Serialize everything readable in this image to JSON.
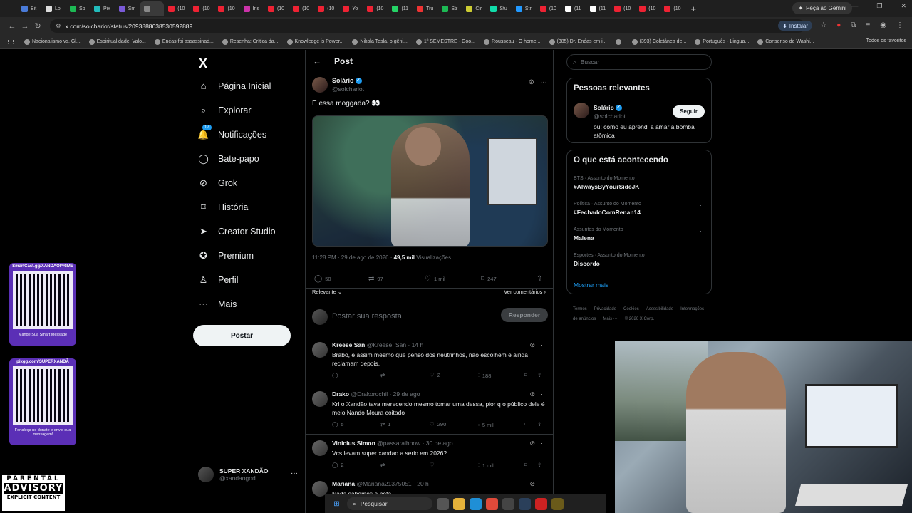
{
  "browser": {
    "tabs": [
      {
        "label": "Bit"
      },
      {
        "label": "Lo"
      },
      {
        "label": "Sp"
      },
      {
        "label": "Pix"
      },
      {
        "label": "Sm"
      },
      {
        "label": ""
      },
      {
        "label": "(10"
      },
      {
        "label": "(10"
      },
      {
        "label": "(10"
      },
      {
        "label": "Ins"
      },
      {
        "label": "(10"
      },
      {
        "label": "(10"
      },
      {
        "label": "(10"
      },
      {
        "label": "Yo"
      },
      {
        "label": "(10"
      },
      {
        "label": "(11"
      },
      {
        "label": "Tru"
      },
      {
        "label": "Str"
      },
      {
        "label": "Cir"
      },
      {
        "label": "Stu"
      },
      {
        "label": "Str"
      },
      {
        "label": "(10"
      },
      {
        "label": "(11"
      },
      {
        "label": "(11"
      },
      {
        "label": "(10"
      },
      {
        "label": "(10"
      },
      {
        "label": "(10"
      }
    ],
    "gemini_label": "Peça ao Gemini",
    "url": "x.com/solchariot/status/2093888638530592889",
    "install_label": "Instalar",
    "bookmarks": [
      "Nacionalismo vs. Gl...",
      "Espiritualidade, Valo...",
      "Enéas foi assassinad...",
      "Resenha: Crítica da...",
      "Knowledge is Power...",
      "Nikola Tesla, o gêni...",
      "1º SEMESTRE - Goo...",
      "Rousseau - O home...",
      "(385) Dr. Enéas em i...",
      "",
      "(393) Coletânea de...",
      "Português - Lingua...",
      "Consenso de Washi..."
    ],
    "all_bookmarks": "Todos os favoritos"
  },
  "sidebar": {
    "logo": "X",
    "items": [
      {
        "label": "Página Inicial",
        "icon": "home-icon"
      },
      {
        "label": "Explorar",
        "icon": "search-icon"
      },
      {
        "label": "Notificações",
        "icon": "bell-icon",
        "badge": "17"
      },
      {
        "label": "Bate-papo",
        "icon": "chat-icon"
      },
      {
        "label": "Grok",
        "icon": "grok-icon"
      },
      {
        "label": "História",
        "icon": "bookmark-icon"
      },
      {
        "label": "Creator Studio",
        "icon": "rocket-icon"
      },
      {
        "label": "Premium",
        "icon": "premium-icon"
      },
      {
        "label": "Perfil",
        "icon": "user-icon"
      },
      {
        "label": "Mais",
        "icon": "more-icon"
      }
    ],
    "post_button": "Postar",
    "account": {
      "name": "SUPER XANDÃO",
      "handle": "@xandaogod"
    }
  },
  "overlay": {
    "qr1_top": "SmartCast.gg/XANDAOPRIME",
    "qr1_bottom": "Mande Sua Smart Message",
    "qr2_top": "pixgg.com/SUPERXANDÃ",
    "qr2_bottom": "Fortaleça no donate e envie sua mensagem!",
    "advisory_1": "PARENTAL",
    "advisory_2": "ADVISORY",
    "advisory_3": "EXPLICIT CONTENT"
  },
  "post": {
    "header": "Post",
    "author_name": "Solário",
    "author_handle": "@solchariot",
    "text": "E essa moggada? 👀",
    "time": "11:28 PM · 29 de ago de 2026 · ",
    "views_count": "49,5 mil",
    "views_label": " Visualizações",
    "replies": "50",
    "reposts": "97",
    "likes": "1 mil",
    "bookmarks": "247",
    "sort_label": "Relevante",
    "comments_link": "Ver comentários",
    "reply_placeholder": "Postar sua resposta",
    "reply_button": "Responder"
  },
  "replies": [
    {
      "name": "Kreese San",
      "handle": "@Kreese_San",
      "time": "· 14 h",
      "text": "Brabo, é assim mesmo que penso dos neutrinhos, não escolhem e ainda reclamam depois.",
      "replies": "",
      "reposts": "",
      "likes": "2",
      "views": "188"
    },
    {
      "name": "Drako",
      "handle": "@Drakorochil",
      "time": "· 29 de ago",
      "text": "Krl o Xandão tava merecendo mesmo tomar uma dessa, pior q o público dele é meio Nando Moura coitado",
      "replies": "5",
      "reposts": "1",
      "likes": "290",
      "views": "5 mil"
    },
    {
      "name": "Vinicius Simon",
      "handle": "@passaralhoow",
      "time": "· 30 de ago",
      "text": "Vcs levam super xandao a serio em 2026?",
      "replies": "2",
      "reposts": "",
      "likes": "",
      "views": "1 mil"
    },
    {
      "name": "Mariana",
      "handle": "@Mariana21375051",
      "time": "· 20 h",
      "text": "Nada sabemos a beta.",
      "replies": "",
      "reposts": "",
      "likes": "",
      "views": ""
    }
  ],
  "right": {
    "search_placeholder": "Buscar",
    "relevant_title": "Pessoas relevantes",
    "relevant_name": "Solário",
    "relevant_handle": "@solchariot",
    "follow_label": "Seguir",
    "relevant_bio": "ou: como eu aprendi a amar a bomba atômica",
    "trends_title": "O que está acontecendo",
    "trends": [
      {
        "meta": "BTS · Assunto do Momento",
        "name": "#AlwaysByYourSideJK"
      },
      {
        "meta": "Política · Assunto do Momento",
        "name": "#FechadoComRenan14"
      },
      {
        "meta": "Assuntos do Momento",
        "name": "Malena"
      },
      {
        "meta": "Esportes · Assunto do Momento",
        "name": "Discordo"
      }
    ],
    "show_more": "Mostrar mais",
    "footer": [
      "Termos",
      "Privacidade",
      "Cookies",
      "Acessibilidade",
      "Informações de anúncios",
      "Mais ···",
      "© 2026 X Corp."
    ]
  },
  "taskbar": {
    "search_label": "Pesquisar"
  }
}
